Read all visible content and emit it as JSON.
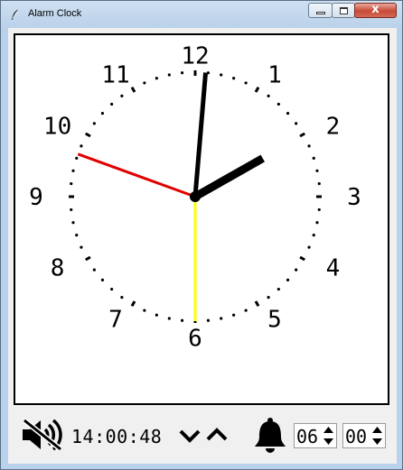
{
  "window": {
    "title": "Alarm Clock",
    "controls": {
      "minimize": "",
      "maximize": "",
      "close": "x"
    }
  },
  "clock": {
    "numbers": [
      "12",
      "1",
      "2",
      "3",
      "4",
      "5",
      "6",
      "7",
      "8",
      "9",
      "10",
      "11"
    ],
    "hands": {
      "hour_color": "#000000",
      "minute_color": "#000000",
      "second_color": "#ffff00",
      "alarm_color": "#e00000"
    }
  },
  "bottom": {
    "time": "14:00:48",
    "alarm_hour": "06",
    "alarm_minute": "00",
    "mute_icon": "speaker-muted-icon",
    "bell_icon": "bell-icon"
  }
}
